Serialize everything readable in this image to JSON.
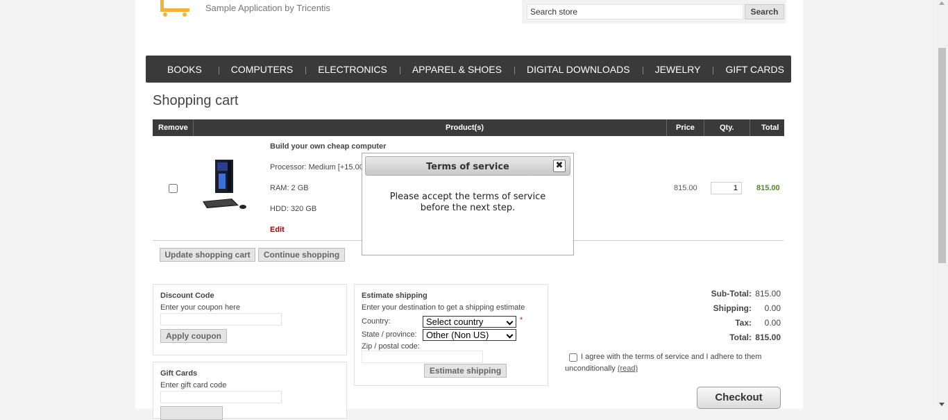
{
  "header": {
    "tagline": "Sample Application by Tricentis",
    "search_value": "Search store",
    "search_button": "Search"
  },
  "nav": [
    "BOOKS",
    "COMPUTERS",
    "ELECTRONICS",
    "APPAREL & SHOES",
    "DIGITAL DOWNLOADS",
    "JEWELRY",
    "GIFT CARDS"
  ],
  "page_title": "Shopping cart",
  "cart": {
    "columns": {
      "remove": "Remove",
      "product": "Product(s)",
      "price": "Price",
      "qty": "Qty.",
      "total": "Total"
    },
    "item": {
      "name": "Build your own cheap computer",
      "attributes": [
        "Processor: Medium [+15.00]",
        "RAM: 2 GB",
        "HDD: 320 GB"
      ],
      "edit": "Edit",
      "price": "815.00",
      "qty": "1",
      "total": "815.00"
    },
    "update_button": "Update shopping cart",
    "continue_button": "Continue shopping"
  },
  "discount": {
    "title": "Discount Code",
    "hint": "Enter your coupon here",
    "button": "Apply coupon"
  },
  "giftcard": {
    "title": "Gift Cards",
    "hint": "Enter gift card code"
  },
  "shipping": {
    "title": "Estimate shipping",
    "hint": "Enter your destination to get a shipping estimate",
    "country_label": "Country:",
    "country_value": "Select country",
    "required_mark": "*",
    "state_label": "State / province:",
    "state_value": "Other (Non US)",
    "zip_label": "Zip / postal code:",
    "button": "Estimate shipping"
  },
  "totals": {
    "subtotal_label": "Sub-Total:",
    "subtotal": "815.00",
    "shipping_label": "Shipping:",
    "shipping": "0.00",
    "tax_label": "Tax:",
    "tax": "0.00",
    "total_label": "Total:",
    "total": "815.00"
  },
  "terms": {
    "text": "I agree with the terms of service and I adhere to them unconditionally",
    "read_link": "(read)"
  },
  "checkout_button": "Checkout",
  "dialog": {
    "title": "Terms of service",
    "message": "Please accept the terms of service before the next step.",
    "close_glyph": "✖"
  }
}
